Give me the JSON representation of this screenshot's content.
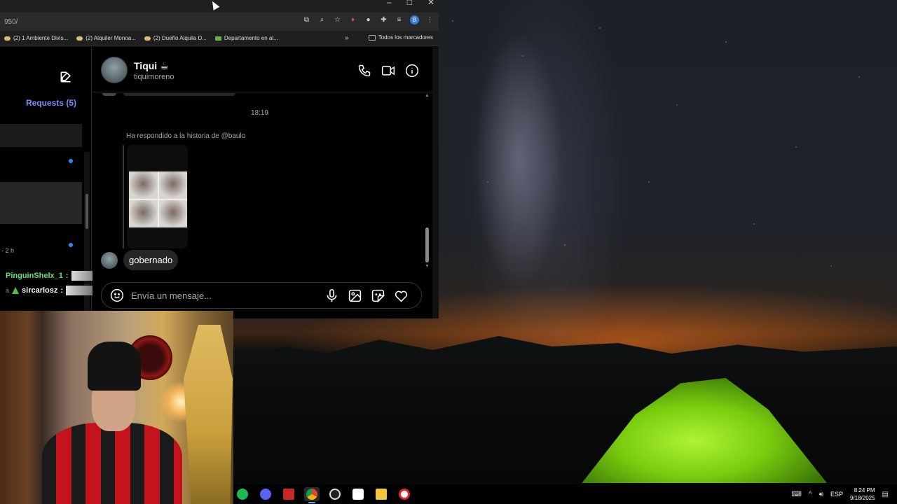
{
  "browser": {
    "url": "950/",
    "window_controls": [
      "–",
      "□",
      "✕"
    ],
    "toolbar_icons": [
      "install-app-icon",
      "zoom-icon",
      "star-icon",
      "extension-red-icon",
      "extension-white-icon",
      "puzzle-icon",
      "media-icon",
      "profile-icon",
      "menu-icon"
    ],
    "profile_letter": "B",
    "bookmarks": [
      {
        "label": "(2) 1 Ambiente Divis...",
        "icon": "marketplace-icon"
      },
      {
        "label": "(2) Alquiler Monoa...",
        "icon": "marketplace-icon"
      },
      {
        "label": "(2) Dueño Alquila D...",
        "icon": "marketplace-icon"
      },
      {
        "label": "Departamento en al...",
        "icon": "listing-icon"
      }
    ],
    "bookmarks_more": "»",
    "all_bookmarks_label": "Todos los marcadores"
  },
  "inbox": {
    "requests_label": "Requests (5)",
    "time_label": "· 2 h"
  },
  "stream_chat": {
    "messages": [
      {
        "user": "PinguinShelx_1",
        "separator": ":",
        "color": "#59e37a"
      },
      {
        "prefix": "a",
        "user": "sircarlosz",
        "separator": ":",
        "color": "#ffffff"
      }
    ]
  },
  "chat": {
    "contact_name": "Tiqui ☕",
    "contact_username": "tiquimoreno",
    "timestamp": "18:19",
    "story_reply_label": "Ha respondido a la historia de @baulo",
    "last_message": "gobernado",
    "composer_placeholder": "Envía un mensaje..."
  },
  "taskbar": {
    "apps": [
      {
        "name": "spotify-icon",
        "color": "#1db954"
      },
      {
        "name": "discord-icon",
        "color": "#5865f2"
      },
      {
        "name": "voicemeeter-icon",
        "color": "#c62828"
      },
      {
        "name": "chrome-icon",
        "color": "#4285f4",
        "active": true
      },
      {
        "name": "obs-icon",
        "color": "#dddddd"
      },
      {
        "name": "tiktok-icon",
        "color": "#ffffff"
      },
      {
        "name": "file-explorer-icon",
        "color": "#f4c542"
      },
      {
        "name": "opera-icon",
        "color": "#e0242c"
      }
    ],
    "language": "ESP",
    "time": "8:24 PM",
    "date": "9/18/2025"
  }
}
